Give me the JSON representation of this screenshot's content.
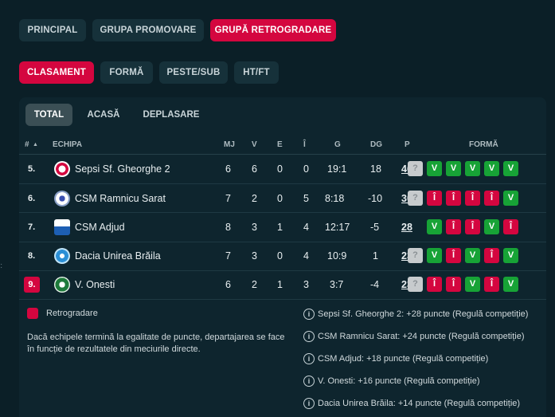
{
  "groups": [
    "PRINCIPAL",
    "GRUPA PROMOVARE",
    "GRUPĂ RETROGRADARE"
  ],
  "views": [
    "CLASAMENT",
    "FORMĂ",
    "PESTE/SUB",
    "HT/FT"
  ],
  "location_tabs": [
    "TOTAL",
    "ACASĂ",
    "DEPLASARE"
  ],
  "table": {
    "headers": {
      "rank": "#",
      "sort_icon": "▲",
      "team": "ECHIPA",
      "mj": "MJ",
      "v": "V",
      "e": "E",
      "i": "Î",
      "g": "G",
      "dg": "DG",
      "p": "P",
      "form": "FORMĂ"
    },
    "rows": [
      {
        "rank": "5.",
        "team": "Sepsi Sf. Gheorghe 2",
        "mj": "6",
        "v": "6",
        "e": "0",
        "i": "0",
        "g": "19:1",
        "dg": "18",
        "p": "46",
        "form": [
          "?",
          "V",
          "V",
          "V",
          "V",
          "V"
        ]
      },
      {
        "rank": "6.",
        "team": "CSM Ramnicu Sarat",
        "mj": "7",
        "v": "2",
        "e": "0",
        "i": "5",
        "g": "8:18",
        "dg": "-10",
        "p": "30",
        "form": [
          "?",
          "Î",
          "Î",
          "Î",
          "Î",
          "V"
        ]
      },
      {
        "rank": "7.",
        "team": "CSM Adjud",
        "mj": "8",
        "v": "3",
        "e": "1",
        "i": "4",
        "g": "12:17",
        "dg": "-5",
        "p": "28",
        "form": [
          "V",
          "Î",
          "Î",
          "V",
          "Î"
        ]
      },
      {
        "rank": "8.",
        "team": "Dacia Unirea Brăila",
        "mj": "7",
        "v": "3",
        "e": "0",
        "i": "4",
        "g": "10:9",
        "dg": "1",
        "p": "23",
        "form": [
          "?",
          "V",
          "Î",
          "V",
          "Î",
          "V"
        ]
      },
      {
        "rank": "9.",
        "team": "V. Onesti",
        "mj": "6",
        "v": "2",
        "e": "1",
        "i": "3",
        "g": "3:7",
        "dg": "-4",
        "p": "23",
        "form": [
          "?",
          "Î",
          "Î",
          "V",
          "Î",
          "V"
        ]
      }
    ]
  },
  "legend": {
    "relegation": "Retrogradare"
  },
  "tiebreak_note": "Dacă echipele termină la egalitate de puncte, departajarea se face în funcție de rezultatele din meciurile directe.",
  "notes": [
    "Sepsi Sf. Gheorghe 2: +28 puncte (Regulă competiție)",
    "CSM Ramnicu Sarat: +24 puncte (Regulă competiție)",
    "CSM Adjud: +18 puncte (Regulă competiție)",
    "V. Onesti: +16 puncte (Regulă competiție)",
    "Dacia Unirea Brăila: +14 puncte (Regulă competiție)"
  ],
  "info_glyph": "i",
  "colors": {
    "accent": "#d4063f",
    "win": "#17a336",
    "loss": "#d4063f",
    "unknown": "#c7cbcd",
    "background": "#0b1f27"
  }
}
